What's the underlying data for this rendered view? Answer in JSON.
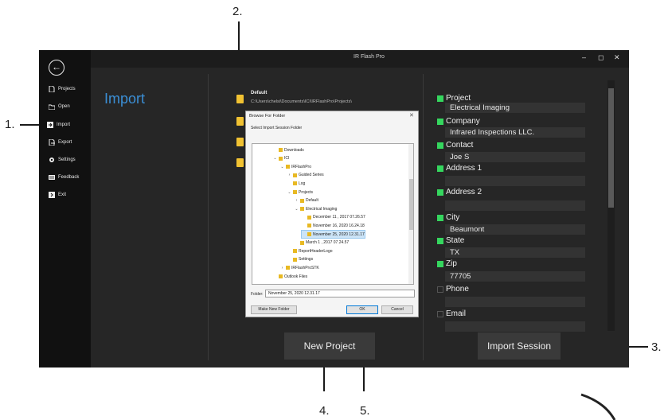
{
  "callouts": [
    "1.",
    "2.",
    "3.",
    "4.",
    "5."
  ],
  "window": {
    "title": "IR Flash Pro",
    "minimize": "‒",
    "maximize": "◻",
    "close": "✕"
  },
  "sidebar": {
    "back_icon": "back-arrow-icon",
    "items": [
      {
        "label": "Projects",
        "icon": "file-icon"
      },
      {
        "label": "Open",
        "icon": "folder-open-icon"
      },
      {
        "label": "Import",
        "icon": "import-icon"
      },
      {
        "label": "Export",
        "icon": "export-icon"
      },
      {
        "label": "Settings",
        "icon": "gear-icon"
      },
      {
        "label": "Feedback",
        "icon": "feedback-icon"
      },
      {
        "label": "Exit",
        "icon": "exit-icon"
      }
    ]
  },
  "main": {
    "title": "Import",
    "default_label": "Default",
    "default_path": "C:\\Users\\chelsi\\Documents\\ICI\\IRFlashPro\\Projects\\",
    "new_project": "New Project",
    "import_session": "Import Session"
  },
  "form": {
    "fields": [
      {
        "label": "Project",
        "value": "Electrical Imaging",
        "checked": true
      },
      {
        "label": "Company",
        "value": "Infrared Inspections LLC.",
        "checked": true
      },
      {
        "label": "Contact",
        "value": "Joe S",
        "checked": true
      },
      {
        "label": "Address 1",
        "value": "",
        "checked": true
      },
      {
        "label": "Address 2",
        "value": "",
        "checked": true
      },
      {
        "label": "City",
        "value": "Beaumont",
        "checked": true
      },
      {
        "label": "State",
        "value": "TX",
        "checked": true
      },
      {
        "label": "Zip",
        "value": "77705",
        "checked": true
      },
      {
        "label": "Phone",
        "value": "",
        "checked": false
      },
      {
        "label": "Email",
        "value": "",
        "checked": false
      }
    ]
  },
  "dialog": {
    "title": "Browse For Folder",
    "close": "✕",
    "subtitle": "Select Import Session Folder",
    "tree": [
      {
        "label": "Downloads",
        "arrow": "",
        "indent": 0
      },
      {
        "label": "ICI",
        "arrow": "⌄",
        "indent": 0
      },
      {
        "label": "IRFlashPro",
        "arrow": "⌄",
        "indent": 1
      },
      {
        "label": "Guided Series",
        "arrow": "›",
        "indent": 2
      },
      {
        "label": "Log",
        "arrow": "",
        "indent": 2
      },
      {
        "label": "Projects",
        "arrow": "⌄",
        "indent": 2
      },
      {
        "label": "Default",
        "arrow": "›",
        "indent": 3
      },
      {
        "label": "Electrical Imaging",
        "arrow": "⌄",
        "indent": 3
      },
      {
        "label": "December 11 , 2017 07.26.57",
        "arrow": "",
        "indent": 4
      },
      {
        "label": "November 16, 2020 16.24.18",
        "arrow": "",
        "indent": 4
      },
      {
        "label": "November 25, 2020 12.31.17",
        "arrow": "",
        "indent": 4,
        "selected": true
      },
      {
        "label": "March 1 , 2017 07.24.57",
        "arrow": "",
        "indent": 3
      },
      {
        "label": "ReportHeaderLogo",
        "arrow": "",
        "indent": 2
      },
      {
        "label": "Settings",
        "arrow": "",
        "indent": 2
      },
      {
        "label": "IRFlashProSTK",
        "arrow": "›",
        "indent": 1
      },
      {
        "label": "Outlook Files",
        "arrow": "",
        "indent": 0
      }
    ],
    "folder_label": "Folder:",
    "folder_value": "November 25, 2020 12.31.17",
    "make_new_folder": "Make New Folder",
    "ok": "OK",
    "cancel": "Cancel"
  }
}
